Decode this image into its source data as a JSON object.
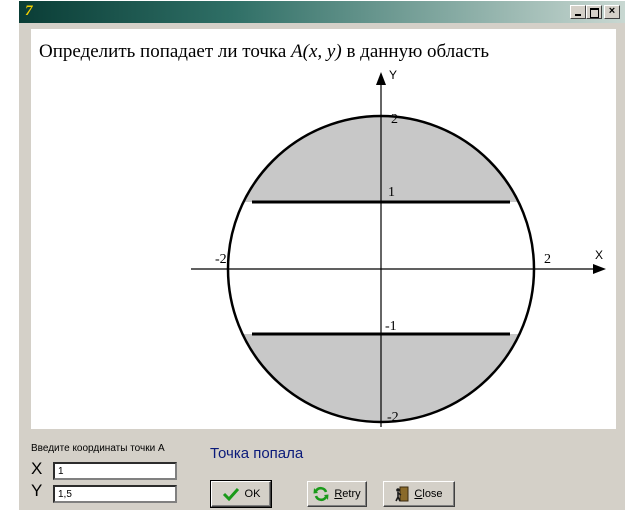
{
  "window": {
    "app_icon": "7",
    "title_buttons": {
      "minimize": "_",
      "maximize": "",
      "close": "×"
    }
  },
  "heading": {
    "pre": "Определить попадает ли точка ",
    "math": "A(x, y)",
    "post": " в данную область"
  },
  "plot": {
    "x_axis_label": "X",
    "y_axis_label": "Y",
    "x_ticks": [
      "-2",
      "2"
    ],
    "y_ticks": [
      "2",
      "1",
      "-1",
      "-2"
    ],
    "circle_radius": 2,
    "band_lines_y": [
      1,
      -1
    ],
    "shaded_regions": [
      "y > 1",
      "y < -1"
    ],
    "colors": {
      "shade": "#c8c8c8",
      "line": "#000000",
      "canvas": "#ffffff"
    }
  },
  "form": {
    "coords_label": "Введите координаты точки А",
    "x_label": "X",
    "y_label": "Y",
    "x_value": "1",
    "y_value": "1,5",
    "result_text": "Точка попала"
  },
  "buttons": {
    "ok": {
      "label": "OK",
      "icon": "check-icon"
    },
    "retry": {
      "label_first": "R",
      "label_rest": "etry",
      "icon": "refresh-icon"
    },
    "close": {
      "label_first": "C",
      "label_rest": "lose",
      "icon": "door-exit-icon"
    }
  },
  "colors": {
    "dialog_bg": "#d4d0c8",
    "result_text": "#0a1a7a",
    "titlebar_start": "#0a3d36",
    "titlebar_end": "#c9d8d2",
    "ok_check": "#1a9a1a",
    "retry_arrows": "#1a9a1a"
  }
}
